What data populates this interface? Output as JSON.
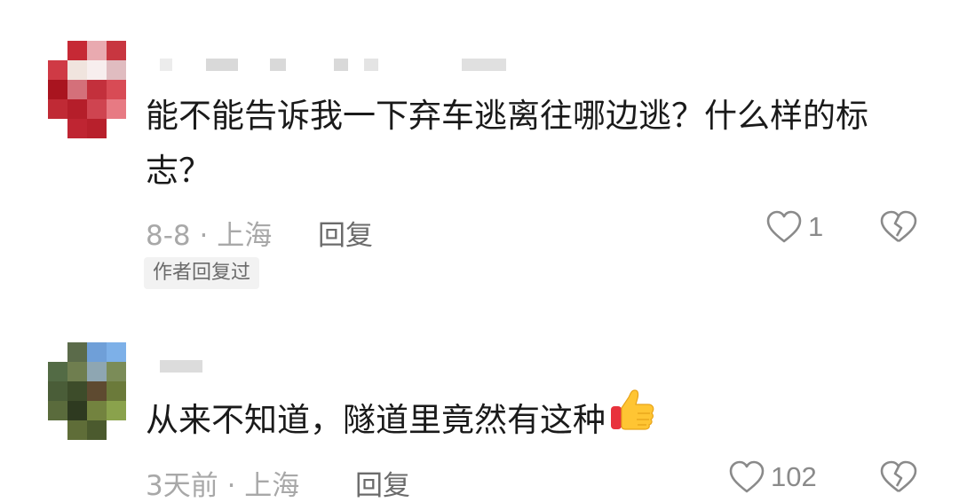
{
  "comments": [
    {
      "text_line1": "能不能告诉我一下弃车逃离往哪边逃？什么样的标",
      "text_line2": "志？",
      "date": "8-8",
      "location": "上海",
      "reply_label": "回复",
      "like_count": "1",
      "author_reply_badge": "作者回复过",
      "avatar_icon": "pixelated-avatar-red",
      "like_icon": "heart-outline-icon",
      "dislike_icon": "broken-heart-icon"
    },
    {
      "text": "从来不知道，隧道里竟然有这种",
      "emoji": "thumbs-up-emoji",
      "date": "3天前",
      "location": "上海",
      "reply_label": "回复",
      "like_count": "102",
      "avatar_icon": "pixelated-avatar-green",
      "like_icon": "heart-outline-icon",
      "dislike_icon": "broken-heart-icon"
    }
  ],
  "colors": {
    "text_primary": "#1a1a1a",
    "text_meta": "#a8a8a8",
    "reply": "#6b6b6b",
    "badge_bg": "#f2f2f2",
    "icon_stroke": "#8a8a8a"
  }
}
